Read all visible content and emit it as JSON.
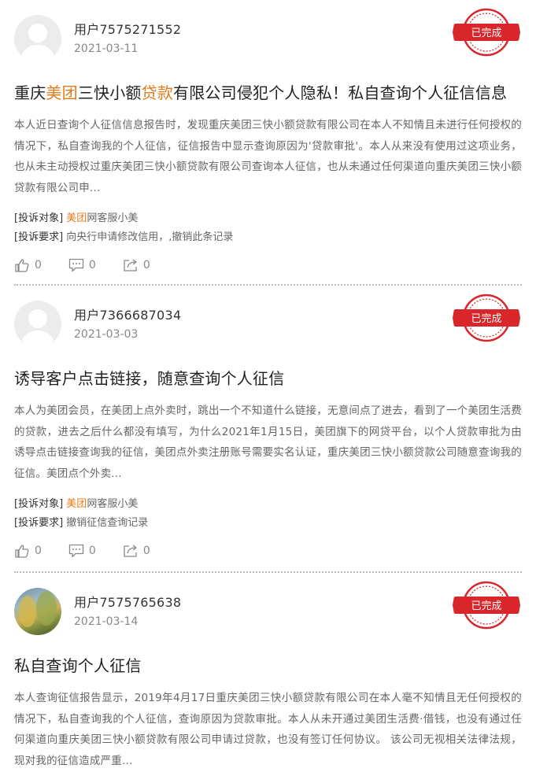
{
  "posts": [
    {
      "username": "用户7575271552",
      "date": "2021-03-11",
      "status": "已完成",
      "title": {
        "t1": "重庆",
        "t2": "美团",
        "t3": "三快小额",
        "t4": "贷款",
        "t5": "有限公司侵犯个人隐私！私自查询个人征信信息"
      },
      "body": "本人近日查询个人征信信息报告时，发现重庆美团三快小额贷款有限公司在本人不知情且未进行任何授权的情况下，私自查询我的个人征信，征信报告中显示查询原因为'贷款审批'。本人从来没有使用过这项业务，也从未主动授权过重庆美团三快小额贷款有限公司查询本人征信，也从未通过任何渠道向重庆美团三快小额贷款有限公司申...",
      "target_key": "[投诉对象]",
      "target_org": "美团",
      "target_rest": "网客服小美",
      "demand_key": "[投诉要求]",
      "demand": "向央行申请修改信用，,撤销此条记录",
      "likes": "0",
      "comments": "0",
      "shares": "0"
    },
    {
      "username": "用户7366687034",
      "date": "2021-03-03",
      "status": "已完成",
      "title": "诱导客户点击链接，随意查询个人征信",
      "body": "本人为美团会员，在美团上点外卖时，跳出一个不知道什么链接，无意间点了进去，看到了一个美团生活费的贷款，进去之后什么都没有填写，为什么2021年1月15日，美团旗下的网贷平台，以个人贷款审批为由诱导点击链接查询我的征信，美团点外卖注册账号需要实名认证，重庆美团三快小额贷款公司随意查询我的征信。美团点个外卖...",
      "target_key": "[投诉对象]",
      "target_org": "美团",
      "target_rest": "网客服小美",
      "demand_key": "[投诉要求]",
      "demand": "撤销征信查询记录",
      "likes": "0",
      "comments": "0",
      "shares": "0"
    },
    {
      "username": "用户7575765638",
      "date": "2021-03-14",
      "status": "已完成",
      "title": "私自查询个人征信",
      "body": "本人查询征信报告显示，2019年4月17日重庆美团三快小额贷款有限公司在本人毫不知情且无任何授权的情况下，私自查询我的个人征信，查询原因为贷款审批。本人从未开通过美团生活费·借钱，也没有通过任何渠道向重庆美团三快小额贷款有限公司申请过贷款，也没有签订任何协议。 该公司无视相关法律法规，现对我的征信造成严重..."
    }
  ],
  "colors": {
    "highlight": "#e07b1a",
    "stamp": "#d9262b"
  },
  "icons": {
    "like": "thumbs-up-icon",
    "comment": "comment-icon",
    "share": "share-icon"
  }
}
